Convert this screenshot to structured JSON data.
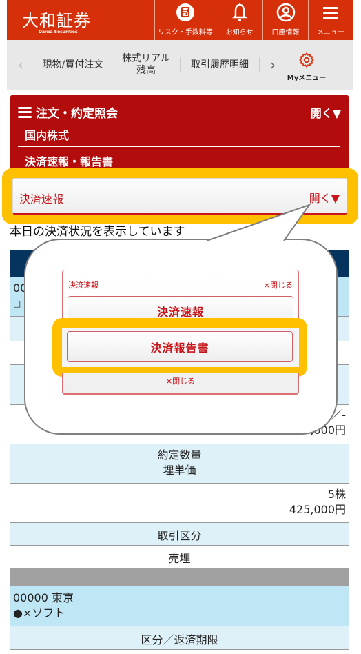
{
  "header": {
    "logo_main": "大和証券",
    "logo_sub": "Daiwa Securities",
    "buttons": [
      {
        "icon": "document-check-icon",
        "label": "リスク・手数料等"
      },
      {
        "icon": "bell-icon",
        "label": "お知らせ"
      },
      {
        "icon": "account-circle-icon",
        "label": "口座情報"
      },
      {
        "icon": "hamburger-menu-icon",
        "label": "メニュー"
      }
    ],
    "colors": {
      "brand": "#d6300b"
    }
  },
  "subnav": {
    "prev_icon": "chevron-left-icon",
    "items": [
      "現物/買付注文",
      "株式リアル残高",
      "取引履歴明細"
    ],
    "next_icon": "chevron-right-icon",
    "my_menu": {
      "icon": "gear-icon",
      "label": "Myメニュー"
    }
  },
  "section": {
    "title": "注文・約定照会",
    "open_label": "開く▼",
    "category": "国内株式",
    "subcategory": "決済速報・報告書",
    "colors": {
      "panel": "#b20c0c"
    }
  },
  "accordion": {
    "title": "決済速報",
    "open_label": "開く▼",
    "colors": {
      "text": "#c8141a",
      "highlight": "#ffc000"
    }
  },
  "intro_text": "本日の決済状況を表示しています",
  "table": {
    "first_record": {
      "code_name_partial": "00",
      "line2_partial": "□"
    },
    "rows_visible": [
      {
        "type": "value",
        "line1": "／-",
        "line2": "413,000円"
      },
      {
        "type": "label",
        "line1": "約定数量",
        "line2": "埋単価"
      },
      {
        "type": "value",
        "line1": "5株",
        "line2": "425,000円"
      },
      {
        "type": "label",
        "line1": "取引区分"
      },
      {
        "type": "value-center",
        "line1": "売埋"
      }
    ],
    "second_record": {
      "code_name": "00000 東京",
      "line2": "●×ソフト",
      "next_label": "区分／返済期限"
    }
  },
  "popup": {
    "title": "決済速報",
    "close_top": "×閉じる",
    "buttons": [
      "決済速報",
      "決済報告書"
    ],
    "highlighted": "決済報告書",
    "close_bottom": "×閉じる"
  }
}
